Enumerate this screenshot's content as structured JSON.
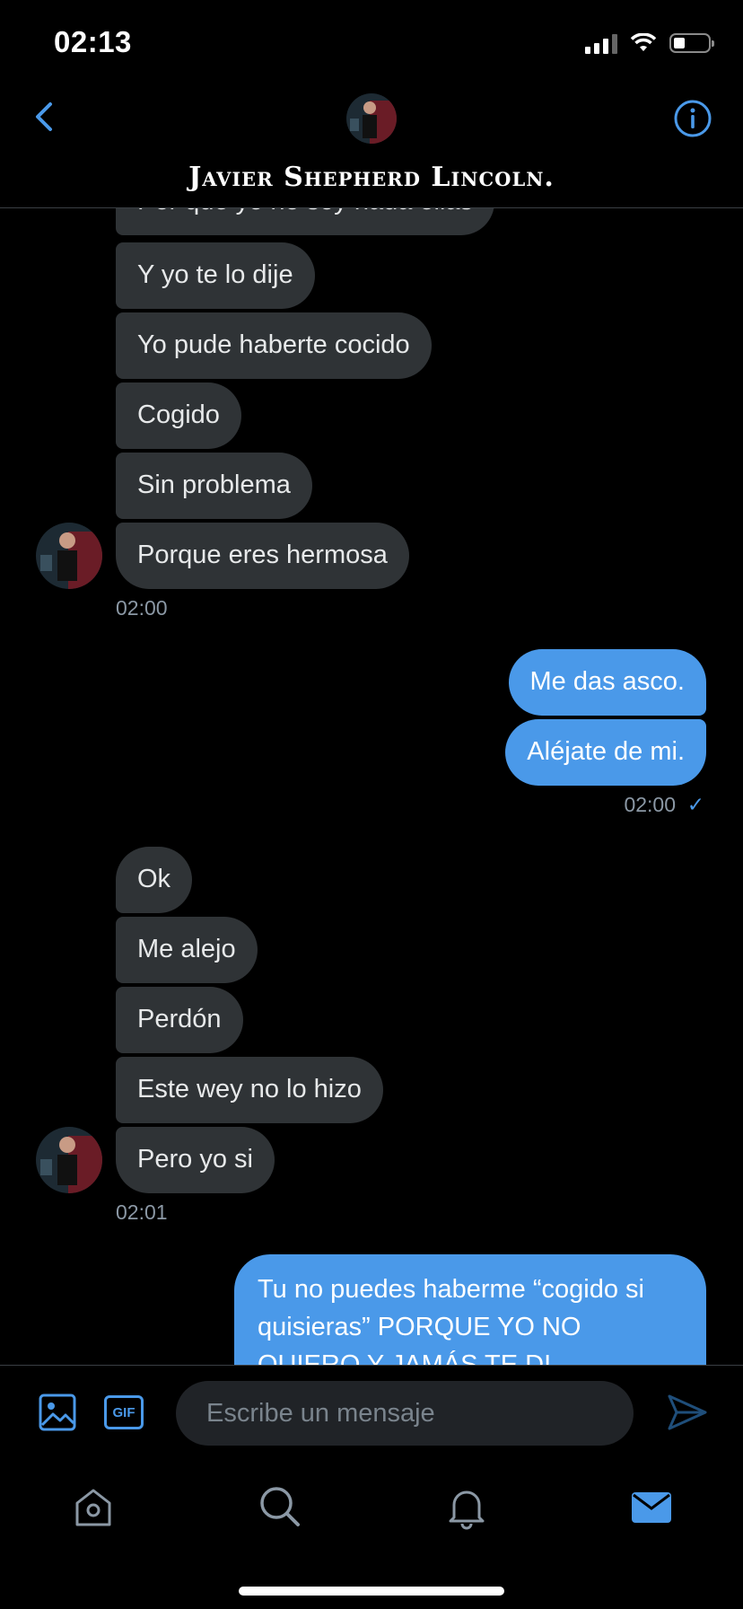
{
  "status_bar": {
    "time": "02:13"
  },
  "header": {
    "contact_name": "Javier Shepherd Lincoln."
  },
  "messages": {
    "group1": [
      "Por qué yo no soy nada ellas",
      "Y yo te lo dije",
      "Yo pude haberte cocido",
      "Cogido",
      "Sin problema",
      "Porque eres hermosa"
    ],
    "group1_time": "02:00",
    "group2": [
      "Me das asco.",
      "Aléjate de mi."
    ],
    "group2_time": "02:00",
    "group2_read": "✓",
    "group3": [
      "Ok",
      "Me alejo",
      "Perdón",
      "Este wey no lo hizo",
      "Pero yo si"
    ],
    "group3_time": "02:01",
    "group4": [
      "Tu no puedes haberme “cogido si quisieras” PORQUE YO NO QUIERO Y JAMÁS TE DI"
    ]
  },
  "composer": {
    "placeholder": "Escribe un mensaje",
    "gif_label": "GIF"
  },
  "colors": {
    "accent": "#4a99e9",
    "incoming_bubble": "#2f3336",
    "background": "#000000"
  },
  "icons": [
    "back-chevron-icon",
    "info-icon",
    "image-icon",
    "gif-icon",
    "send-icon",
    "home-icon",
    "search-icon",
    "bell-icon",
    "mail-icon"
  ]
}
